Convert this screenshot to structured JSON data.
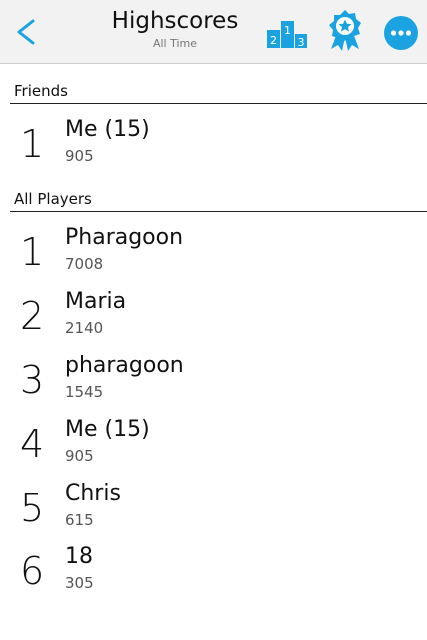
{
  "header": {
    "title": "Highscores",
    "subtitle": "All Time",
    "accent": "#1aa3e0"
  },
  "podium_digits": [
    "2",
    "1",
    "3"
  ],
  "friends": {
    "label": "Friends",
    "rows": [
      {
        "rank": "1",
        "name": "Me (15)",
        "score": "905"
      }
    ]
  },
  "all_players": {
    "label": "All Players",
    "rows": [
      {
        "rank": "1",
        "name": "Pharagoon",
        "score": "7008"
      },
      {
        "rank": "2",
        "name": "Maria",
        "score": "2140"
      },
      {
        "rank": "3",
        "name": "pharagoon",
        "score": "1545"
      },
      {
        "rank": "4",
        "name": "Me (15)",
        "score": "905"
      },
      {
        "rank": "5",
        "name": "Chris",
        "score": "615"
      },
      {
        "rank": "6",
        "name": "18",
        "score": "305"
      }
    ]
  },
  "icons": [
    "chevron-left-icon",
    "podium-icon",
    "award-ribbon-icon",
    "more-options-icon"
  ]
}
